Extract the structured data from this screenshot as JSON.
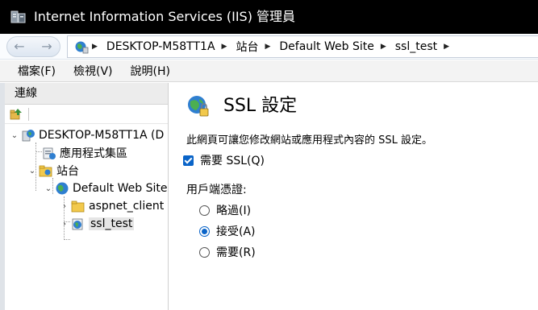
{
  "window": {
    "title": "Internet Information Services (IIS) 管理員",
    "icon": "iis-manager-icon"
  },
  "navigation": {
    "back_icon": "arrow-left-icon",
    "forward_icon": "arrow-right-icon",
    "breadcrumb": [
      "DESKTOP-M58TT1A",
      "站台",
      "Default Web Site",
      "ssl_test"
    ],
    "separator": "▶"
  },
  "menu": {
    "items": [
      "檔案(F)",
      "檢視(V)",
      "說明(H)"
    ]
  },
  "connections": {
    "header": "連線",
    "tree": [
      {
        "label": "DESKTOP-M58TT1A (D",
        "icon": "server-icon",
        "expanded": true
      },
      {
        "label": "應用程式集區",
        "icon": "app-pool-icon"
      },
      {
        "label": "站台",
        "icon": "sites-folder-icon",
        "expanded": true
      },
      {
        "label": "Default Web Site",
        "icon": "globe-icon",
        "expanded": true
      },
      {
        "label": "aspnet_client",
        "icon": "folder-icon",
        "expanded": false
      },
      {
        "label": "ssl_test",
        "icon": "web-app-icon",
        "expanded": false,
        "selected": true
      }
    ]
  },
  "main": {
    "icon": "ssl-globe-lock-icon",
    "title": "SSL 設定",
    "description": "此網頁可讓您修改網站或應用程式內容的 SSL 設定。",
    "require_ssl": {
      "label": "需要 SSL(Q)",
      "checked": true
    },
    "client_cert": {
      "label": "用戶端憑證:",
      "options": [
        {
          "label": "略過(I)",
          "selected": false
        },
        {
          "label": "接受(A)",
          "selected": true
        },
        {
          "label": "需要(R)",
          "selected": false
        }
      ]
    }
  },
  "colors": {
    "titlebar": "#000000",
    "accent": "#0a64c8",
    "selection": "#e5e5e5"
  }
}
